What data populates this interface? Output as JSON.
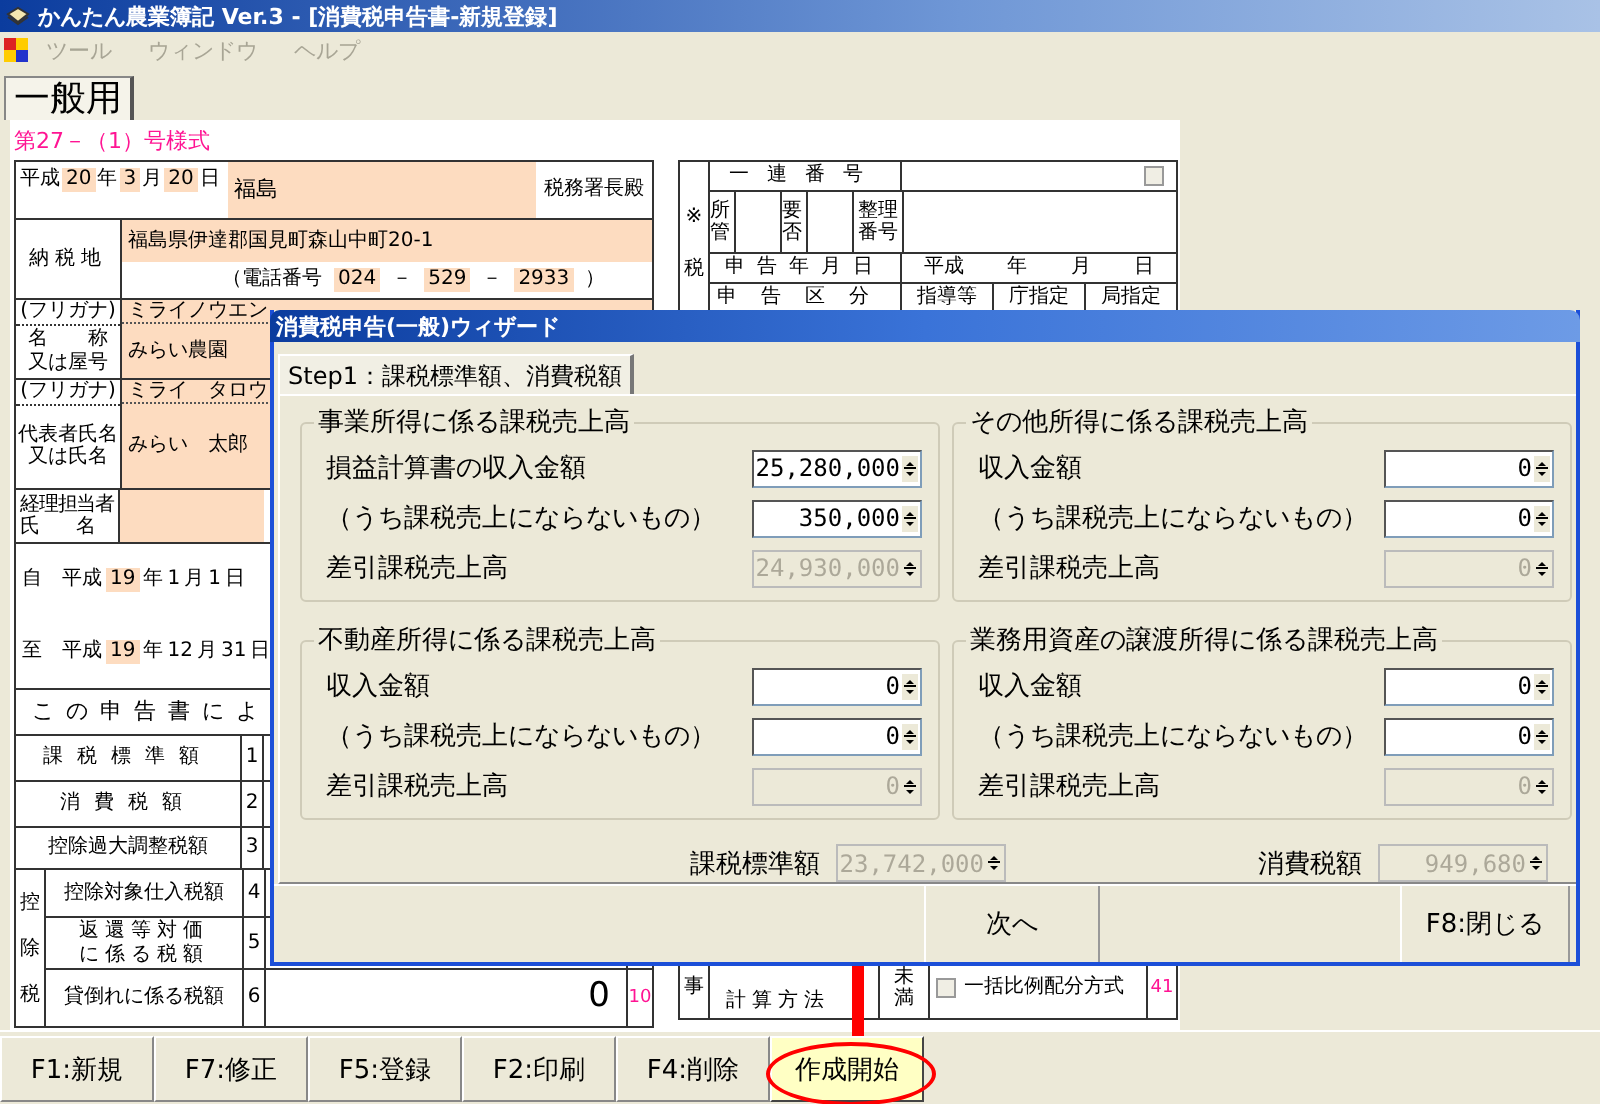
{
  "window": {
    "title": "かんたん農業簿記 Ver.3 - [消費税申告書-新規登録]"
  },
  "menu": [
    {
      "label": "ツール",
      "disabled": true
    },
    {
      "label": "ウィンドウ",
      "disabled": true
    },
    {
      "label": "ヘルプ",
      "disabled": true
    }
  ],
  "tabs": [
    {
      "label": "一般用",
      "selected": true
    }
  ],
  "form": {
    "form_number": "第27－（1）号様式",
    "date_parts": [
      {
        "text": "平成",
        "kind": "label"
      },
      {
        "text": "20",
        "kind": "value"
      },
      {
        "text": "年",
        "kind": "label"
      },
      {
        "text": "3",
        "kind": "value"
      },
      {
        "text": "月",
        "kind": "label"
      },
      {
        "text": "20",
        "kind": "value"
      },
      {
        "text": "日",
        "kind": "label"
      }
    ],
    "tax_office": {
      "value": "福島",
      "suffix": "税務署長殿"
    },
    "address": {
      "label": "納税地",
      "value": "福島県伊達郡国見町森山中町20-1",
      "phone_parts": [
        {
          "text": "（電話番号",
          "kind": "label"
        },
        {
          "text": "024",
          "kind": "value"
        },
        {
          "text": "－",
          "kind": "label"
        },
        {
          "text": "529",
          "kind": "value"
        },
        {
          "text": "－",
          "kind": "label"
        },
        {
          "text": "2933",
          "kind": "value"
        },
        {
          "text": "）",
          "kind": "label"
        }
      ]
    },
    "name_rows": [
      {
        "furigana_label": "(フリガナ)",
        "furigana": "ミライノウエン",
        "label_lines": [
          "名　　称",
          "又は屋号"
        ],
        "value": "みらい農園"
      },
      {
        "furigana_label": "(フリガナ)",
        "furigana": "ミライ　タロウ",
        "label_lines": [
          "代表者氏名",
          "又は氏名"
        ],
        "value": "みらい　太郎"
      }
    ],
    "accountant": {
      "label_lines": [
        "経理担当者",
        "氏　　名"
      ]
    },
    "period": [
      {
        "parts": [
          {
            "text": "自",
            "kind": "label"
          },
          {
            "text": "平成",
            "kind": "label"
          },
          {
            "text": "19",
            "kind": "value"
          },
          {
            "text": "年",
            "kind": "label"
          },
          {
            "text": "1",
            "kind": "label"
          },
          {
            "text": "月",
            "kind": "label"
          },
          {
            "text": "1",
            "kind": "label"
          },
          {
            "text": "日",
            "kind": "label"
          }
        ]
      },
      {
        "parts": [
          {
            "text": "至",
            "kind": "label"
          },
          {
            "text": "平成",
            "kind": "label"
          },
          {
            "text": "19",
            "kind": "value"
          },
          {
            "text": "年",
            "kind": "label"
          },
          {
            "text": "12",
            "kind": "label"
          },
          {
            "text": "月",
            "kind": "label"
          },
          {
            "text": "31",
            "kind": "label"
          },
          {
            "text": "日",
            "kind": "label"
          }
        ]
      }
    ],
    "summary": {
      "heading": "この申告書によ",
      "groups": [
        {
          "rows": [
            {
              "label_lines": [
                "課税標準額"
              ],
              "no": "1"
            },
            {
              "label_lines": [
                "消費税額"
              ],
              "no": "2"
            },
            {
              "label_lines": [
                "控除過大調整税額"
              ],
              "no": "3"
            }
          ]
        },
        {
          "side": "控除税",
          "rows": [
            {
              "label_lines": [
                "控除対象仕入税額"
              ],
              "no": "4"
            },
            {
              "label_lines": [
                "返還等対価",
                "に係る税額"
              ],
              "no": "5"
            },
            {
              "label_lines": [
                "貸倒れに係る税額"
              ],
              "no": "6",
              "amount": "0",
              "ref": "10"
            }
          ]
        }
      ]
    },
    "office_block": {
      "side": "※税",
      "serial_label": "一連番号",
      "serial_checked": false,
      "jurisdiction": "所管",
      "necessity": "要否",
      "reference": "整理番号",
      "date_label": "申告年月日",
      "date_parts": [
        "平成",
        "年",
        "月",
        "日"
      ],
      "class_label": "申告区分",
      "class_options": [
        "指導等",
        "庁指定",
        "局指定"
      ]
    },
    "method_block": {
      "side": "事",
      "label": "計算方法",
      "ratio": "未満",
      "option": {
        "label": "一括比例配分方式",
        "checked": false
      },
      "ref": "41"
    }
  },
  "dialog": {
    "title": "消費税申告(一般)ウィザード",
    "tabs": [
      {
        "label": "Step1：課税標準額、消費税額",
        "selected": true
      }
    ],
    "groups": [
      {
        "title": "事業所得に係る課税売上高",
        "fields": [
          {
            "label": "損益計算書の収入金額",
            "value": "25,280,000",
            "disabled": false
          },
          {
            "label": "（うち課税売上にならないもの）",
            "value": "350,000",
            "disabled": false
          },
          {
            "label": "差引課税売上高",
            "value": "24,930,000",
            "disabled": true
          }
        ]
      },
      {
        "title": "その他所得に係る課税売上高",
        "fields": [
          {
            "label": "収入金額",
            "value": "0",
            "disabled": false
          },
          {
            "label": "（うち課税売上にならないもの）",
            "value": "0",
            "disabled": false
          },
          {
            "label": "差引課税売上高",
            "value": "0",
            "disabled": true
          }
        ]
      },
      {
        "title": "不動産所得に係る課税売上高",
        "fields": [
          {
            "label": "収入金額",
            "value": "0",
            "disabled": false
          },
          {
            "label": "（うち課税売上にならないもの）",
            "value": "0",
            "disabled": false
          },
          {
            "label": "差引課税売上高",
            "value": "0",
            "disabled": true
          }
        ]
      },
      {
        "title": "業務用資産の譲渡所得に係る課税売上高",
        "fields": [
          {
            "label": "収入金額",
            "value": "0",
            "disabled": false
          },
          {
            "label": "（うち課税売上にならないもの）",
            "value": "0",
            "disabled": false
          },
          {
            "label": "差引課税売上高",
            "value": "0",
            "disabled": true
          }
        ]
      }
    ],
    "totals": [
      {
        "label": "課税標準額",
        "value": "23,742,000",
        "disabled": true
      },
      {
        "label": "消費税額",
        "value": "949,680",
        "disabled": true
      }
    ],
    "buttons": [
      {
        "label": "次へ"
      },
      {
        "label": "F8:閉じる"
      }
    ]
  },
  "toolbar": [
    {
      "label": "F1:新規",
      "highlighted": false
    },
    {
      "label": "F7:修正",
      "highlighted": false
    },
    {
      "label": "F5:登録",
      "highlighted": false
    },
    {
      "label": "F2:印刷",
      "highlighted": false
    },
    {
      "label": "F4:削除",
      "highlighted": false
    },
    {
      "label": "作成開始",
      "highlighted": true
    }
  ]
}
